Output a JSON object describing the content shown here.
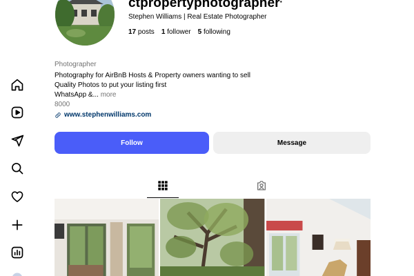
{
  "profile": {
    "username": "ctpropertyphotographer",
    "full_name": "Stephen Williams | Real Estate Photographer",
    "stats": {
      "posts_count": "17",
      "posts_label": "posts",
      "followers_count": "1",
      "followers_label": "follower",
      "following_count": "5",
      "following_label": "following"
    },
    "bio": {
      "category": "Photographer",
      "line1": "Photography for AirBnB Hosts & Property owners wanting to sell",
      "line2": "Quality Photos to put your listing first",
      "line3": "WhatsApp &...",
      "more": "more",
      "line4": "8000",
      "link": "www.stephenwilliams.com"
    }
  },
  "actions": {
    "follow_label": "Follow",
    "message_label": "Message"
  },
  "nav_icons": [
    "home-icon",
    "reels-icon",
    "messages-icon",
    "search-icon",
    "notifications-icon",
    "create-icon",
    "dashboard-icon"
  ],
  "tabs": [
    "posts-grid-icon",
    "tagged-icon"
  ],
  "colors": {
    "follow_button": "#4a5df9",
    "message_button": "#efefef",
    "link": "#00376b",
    "secondary_text": "#737373"
  }
}
